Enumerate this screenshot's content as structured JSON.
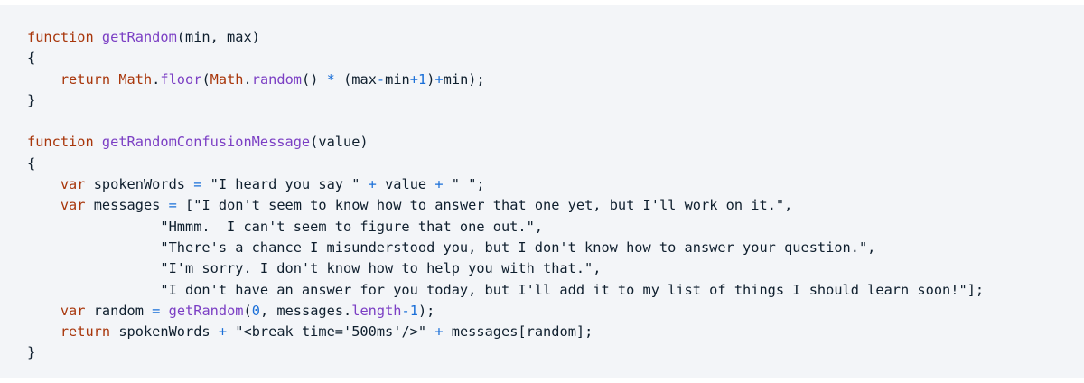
{
  "theme": {
    "background": "#f3f5f8",
    "text": "#0f1f2e",
    "keyword": "#a8360b",
    "function": "#7b3fc4",
    "operator": "#1a6fd8",
    "number": "#1a6fd8"
  },
  "code": {
    "language": "javascript",
    "lines": [
      [
        {
          "t": "k",
          "v": "function"
        },
        {
          "t": "p",
          "v": " "
        },
        {
          "t": "f",
          "v": "getRandom"
        },
        {
          "t": "p",
          "v": "(min, max)"
        }
      ],
      [
        {
          "t": "p",
          "v": "{"
        }
      ],
      [
        {
          "t": "p",
          "v": "    "
        },
        {
          "t": "k",
          "v": "return"
        },
        {
          "t": "p",
          "v": " "
        },
        {
          "t": "k",
          "v": "Math"
        },
        {
          "t": "p",
          "v": "."
        },
        {
          "t": "f",
          "v": "floor"
        },
        {
          "t": "p",
          "v": "("
        },
        {
          "t": "k",
          "v": "Math"
        },
        {
          "t": "p",
          "v": "."
        },
        {
          "t": "f",
          "v": "random"
        },
        {
          "t": "p",
          "v": "() "
        },
        {
          "t": "o",
          "v": "*"
        },
        {
          "t": "p",
          "v": " (max"
        },
        {
          "t": "o",
          "v": "-"
        },
        {
          "t": "p",
          "v": "min"
        },
        {
          "t": "o",
          "v": "+"
        },
        {
          "t": "n",
          "v": "1"
        },
        {
          "t": "p",
          "v": ")"
        },
        {
          "t": "o",
          "v": "+"
        },
        {
          "t": "p",
          "v": "min);"
        }
      ],
      [
        {
          "t": "p",
          "v": "}"
        }
      ],
      [],
      [
        {
          "t": "k",
          "v": "function"
        },
        {
          "t": "p",
          "v": " "
        },
        {
          "t": "f",
          "v": "getRandomConfusionMessage"
        },
        {
          "t": "p",
          "v": "(value)"
        }
      ],
      [
        {
          "t": "p",
          "v": "{"
        }
      ],
      [
        {
          "t": "p",
          "v": "    "
        },
        {
          "t": "k",
          "v": "var"
        },
        {
          "t": "p",
          "v": " spokenWords "
        },
        {
          "t": "o",
          "v": "="
        },
        {
          "t": "p",
          "v": " "
        },
        {
          "t": "s",
          "v": "\"I heard you say \""
        },
        {
          "t": "p",
          "v": " "
        },
        {
          "t": "o",
          "v": "+"
        },
        {
          "t": "p",
          "v": " value "
        },
        {
          "t": "o",
          "v": "+"
        },
        {
          "t": "p",
          "v": " "
        },
        {
          "t": "s",
          "v": "\" \""
        },
        {
          "t": "p",
          "v": ";"
        }
      ],
      [
        {
          "t": "p",
          "v": "    "
        },
        {
          "t": "k",
          "v": "var"
        },
        {
          "t": "p",
          "v": " messages "
        },
        {
          "t": "o",
          "v": "="
        },
        {
          "t": "p",
          "v": " ["
        },
        {
          "t": "s",
          "v": "\"I don't seem to know how to answer that one yet, but I'll work on it.\""
        },
        {
          "t": "p",
          "v": ","
        }
      ],
      [
        {
          "t": "p",
          "v": "                "
        },
        {
          "t": "s",
          "v": "\"Hmmm.  I can't seem to figure that one out.\""
        },
        {
          "t": "p",
          "v": ","
        }
      ],
      [
        {
          "t": "p",
          "v": "                "
        },
        {
          "t": "s",
          "v": "\"There's a chance I misunderstood you, but I don't know how to answer your question.\""
        },
        {
          "t": "p",
          "v": ","
        }
      ],
      [
        {
          "t": "p",
          "v": "                "
        },
        {
          "t": "s",
          "v": "\"I'm sorry. I don't know how to help you with that.\""
        },
        {
          "t": "p",
          "v": ","
        }
      ],
      [
        {
          "t": "p",
          "v": "                "
        },
        {
          "t": "s",
          "v": "\"I don't have an answer for you today, but I'll add it to my list of things I should learn soon!\""
        },
        {
          "t": "p",
          "v": "];"
        }
      ],
      [
        {
          "t": "p",
          "v": "    "
        },
        {
          "t": "k",
          "v": "var"
        },
        {
          "t": "p",
          "v": " random "
        },
        {
          "t": "o",
          "v": "="
        },
        {
          "t": "p",
          "v": " "
        },
        {
          "t": "f",
          "v": "getRandom"
        },
        {
          "t": "p",
          "v": "("
        },
        {
          "t": "n",
          "v": "0"
        },
        {
          "t": "p",
          "v": ", messages."
        },
        {
          "t": "f",
          "v": "length"
        },
        {
          "t": "o",
          "v": "-"
        },
        {
          "t": "n",
          "v": "1"
        },
        {
          "t": "p",
          "v": ");"
        }
      ],
      [
        {
          "t": "p",
          "v": "    "
        },
        {
          "t": "k",
          "v": "return"
        },
        {
          "t": "p",
          "v": " spokenWords "
        },
        {
          "t": "o",
          "v": "+"
        },
        {
          "t": "p",
          "v": " "
        },
        {
          "t": "s",
          "v": "\"<break time='500ms'/>\""
        },
        {
          "t": "p",
          "v": " "
        },
        {
          "t": "o",
          "v": "+"
        },
        {
          "t": "p",
          "v": " messages[random];"
        }
      ],
      [
        {
          "t": "p",
          "v": "}"
        }
      ]
    ]
  }
}
